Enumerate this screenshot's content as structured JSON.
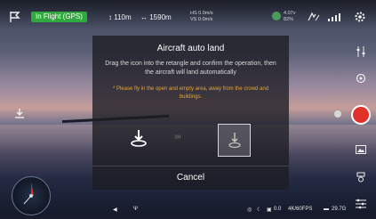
{
  "status_bar": {
    "flight_mode": "In Flight (GPS)",
    "altitude": "110m",
    "distance": "1590m",
    "hs_line1": "HS 0.0m/s",
    "hs_line2": "VS 0.0m/s",
    "battery_line1": "4.07v",
    "battery_line2": "82%"
  },
  "dialog": {
    "title": "Aircraft auto land",
    "description": "Drag the icon into the retangle and confirm the operation, then the aircraft will land automatically",
    "warning": "* Please fly in the open and empty area, away from the crowd and buildings.",
    "arrows": "›››",
    "cancel_label": "Cancel"
  },
  "bottom_bar": {
    "ev": "0.0",
    "resolution": "4K/60FPS",
    "storage": "29.7G"
  },
  "colors": {
    "flight_badge": "#2fa83d",
    "warning_text": "#e9a531",
    "shutter": "#e2302b"
  },
  "icons": [
    "home-point-icon",
    "altitude-icon",
    "distance-icon",
    "gps-icon",
    "signal-icon",
    "rc-signal-icon",
    "settings-icon",
    "sliders-icon",
    "camera-switch-icon",
    "playback-icon",
    "gimbal-icon",
    "auto-land-icon",
    "radar-compass-icon"
  ]
}
